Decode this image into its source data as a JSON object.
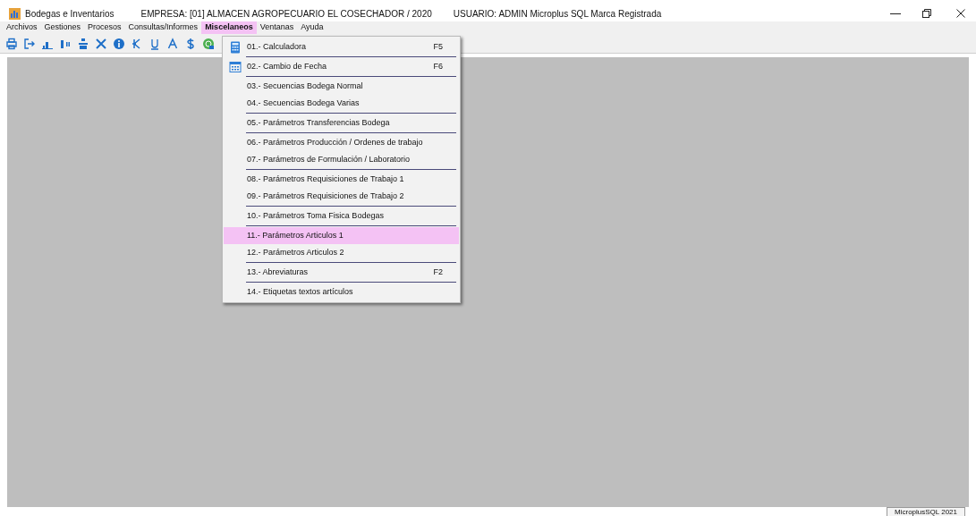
{
  "window": {
    "title": "Bodegas e Inventarios",
    "company": "EMPRESA:  [01] ALMACEN AGROPECUARIO EL COSECHADOR / 2020",
    "user": "USUARIO: ADMIN  Microplus SQL Marca Registrada"
  },
  "menu_bar": [
    {
      "label": "Archivos",
      "selected": false
    },
    {
      "label": "Gestiones",
      "selected": false
    },
    {
      "label": "Procesos",
      "selected": false
    },
    {
      "label": "Consultas/Informes",
      "selected": false
    },
    {
      "label": "Miscelaneos",
      "selected": true
    },
    {
      "label": "Ventanas",
      "selected": false
    },
    {
      "label": "Ayuda",
      "selected": false
    }
  ],
  "dropdown": [
    {
      "label": "01.- Calculadora",
      "shortcut": "F5",
      "kind": "calculator",
      "selected": false,
      "separator_after": true
    },
    {
      "label": "02.- Cambio de Fecha",
      "shortcut": "F6",
      "kind": "calendar",
      "selected": false,
      "separator_after": true
    },
    {
      "label": "03.- Secuencias Bodega Normal",
      "kind": "plain",
      "selected": false,
      "separator_after": false
    },
    {
      "label": "04.- Secuencias Bodega Varias",
      "kind": "plain",
      "selected": false,
      "separator_after": true
    },
    {
      "label": "05.- Parámetros Transferencias Bodega",
      "kind": "plain",
      "selected": false,
      "separator_after": true
    },
    {
      "label": "06.- Parámetros Producción / Ordenes de trabajo",
      "kind": "plain",
      "selected": false,
      "separator_after": false
    },
    {
      "label": "07.- Parámetros de Formulación / Laboratorio",
      "kind": "plain",
      "selected": false,
      "separator_after": true
    },
    {
      "label": "08.- Parámetros Requisiciones de Trabajo 1",
      "kind": "plain",
      "selected": false,
      "separator_after": false
    },
    {
      "label": "09.- Parámetros Requisiciones de Trabajo 2",
      "kind": "plain",
      "selected": false,
      "separator_after": true
    },
    {
      "label": "10.- Parámetros Toma Fisica Bodegas",
      "kind": "plain",
      "selected": false,
      "separator_after": true
    },
    {
      "label": "11.- Parámetros Articulos 1",
      "kind": "plain",
      "selected": true,
      "separator_after": false
    },
    {
      "label": "12.- Parámetros Articulos 2",
      "kind": "plain",
      "selected": false,
      "separator_after": true
    },
    {
      "label": "13.- Abreviaturas",
      "shortcut": "F2",
      "kind": "plain",
      "selected": false,
      "separator_after": true
    },
    {
      "label": "14.- Etiquetas textos artículos",
      "kind": "plain",
      "selected": false,
      "separator_after": false
    }
  ],
  "status_bar": {
    "text": "MicroplusSQL 2021"
  }
}
